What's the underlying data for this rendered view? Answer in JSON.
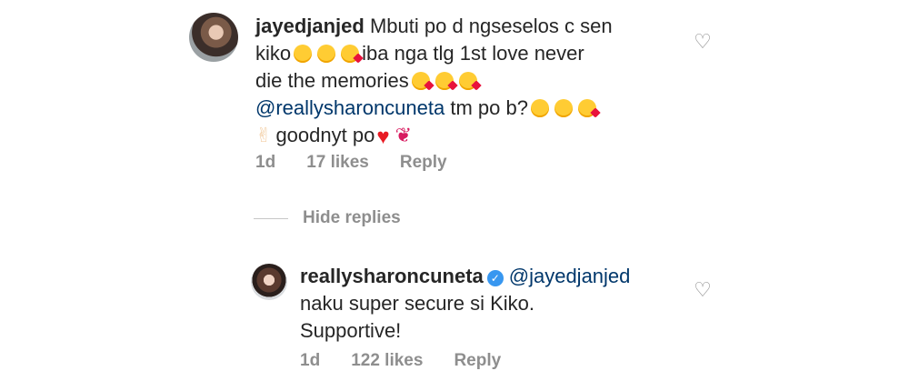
{
  "comment": {
    "username": "jayedjanjed",
    "line1": "Mbuti po d ngseselos c sen",
    "line2a": "kiko",
    "line2b": "iba nga tlg 1st love never",
    "line3": "die the memories",
    "mention": "@reallysharoncuneta",
    "line4b": "tm po b?",
    "line5": "goodnyt po",
    "time": "1d",
    "likes": "17 likes",
    "reply": "Reply"
  },
  "hide_replies": "Hide replies",
  "reply": {
    "username": "reallysharoncuneta",
    "mention": "@jayedjanjed",
    "line1": "naku super secure si Kiko.",
    "line2": "Supportive!",
    "time": "1d",
    "likes": "122 likes",
    "reply": "Reply"
  },
  "icons": {
    "like": "heart-outline-icon",
    "verified": "verified-badge-icon"
  },
  "colors": {
    "text": "#262626",
    "meta": "#8e8e8e",
    "mention": "#00376b",
    "verified": "#3897f0"
  }
}
